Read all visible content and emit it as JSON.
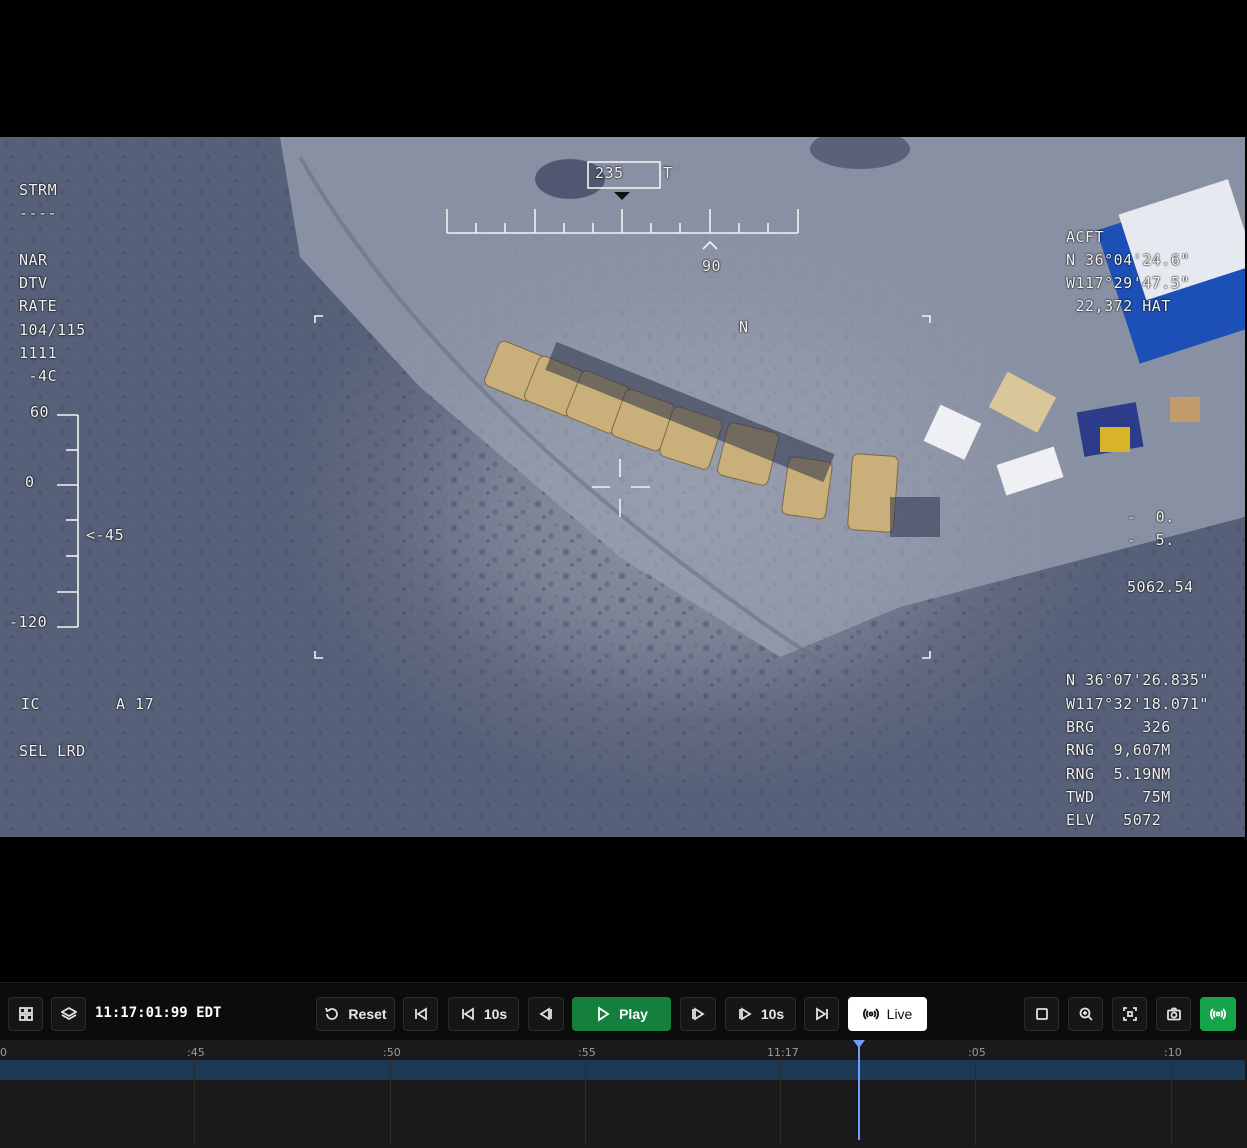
{
  "hud": {
    "heading_box": "235",
    "heading_ref": "T",
    "scale_value": "90",
    "north": "N",
    "left_lines": [
      "STRM",
      "----",
      "",
      "NAR",
      "DTV",
      "RATE",
      "104/115",
      "1111",
      " -4C"
    ],
    "elev_scale_top": "60",
    "elev_scale_mid": "0",
    "elev_scale_bottom": "-120",
    "elev_pointer": "<-45",
    "ic": "IC",
    "a17": "A 17",
    "sel_lrd": "SEL LRD",
    "acft_lines": [
      "ACFT",
      "N 36°04'24.6\"",
      "W117°29'47.5\"",
      " 22,372 HAT"
    ],
    "right_mid_lines": [
      "-  0.",
      "-  5."
    ],
    "right_value": "5062.54",
    "target_lines": [
      "N 36°07'26.835\"",
      "W117°32'18.071\"",
      "BRG     326",
      "RNG  9,607M",
      "RNG  5.19NM",
      "TWD     75M",
      "ELV   5072"
    ]
  },
  "controls": {
    "time": "11:17:01:99 EDT",
    "reset_label": "Reset",
    "back10_label": "10s",
    "play_label": "Play",
    "fwd10_label": "10s",
    "live_label": "Live",
    "icons": [
      "grid-icon",
      "layers-icon",
      "reset-icon",
      "skip-start-icon",
      "back-10-icon",
      "step-back-icon",
      "play-icon",
      "step-forward-icon",
      "forward-10-icon",
      "skip-end-icon",
      "live-icon",
      "square-icon",
      "zoom-in-icon",
      "fit-screen-icon",
      "camera-icon",
      "broadcast-icon"
    ],
    "accent_color": "#15803d",
    "live_active_color": "#16a34a"
  },
  "timeline": {
    "ticks": [
      "0",
      ":45",
      ":50",
      ":55",
      "11:17",
      ":05",
      ":10"
    ],
    "playhead_color": "#6f9bff",
    "track_color": "#1c3a55"
  }
}
